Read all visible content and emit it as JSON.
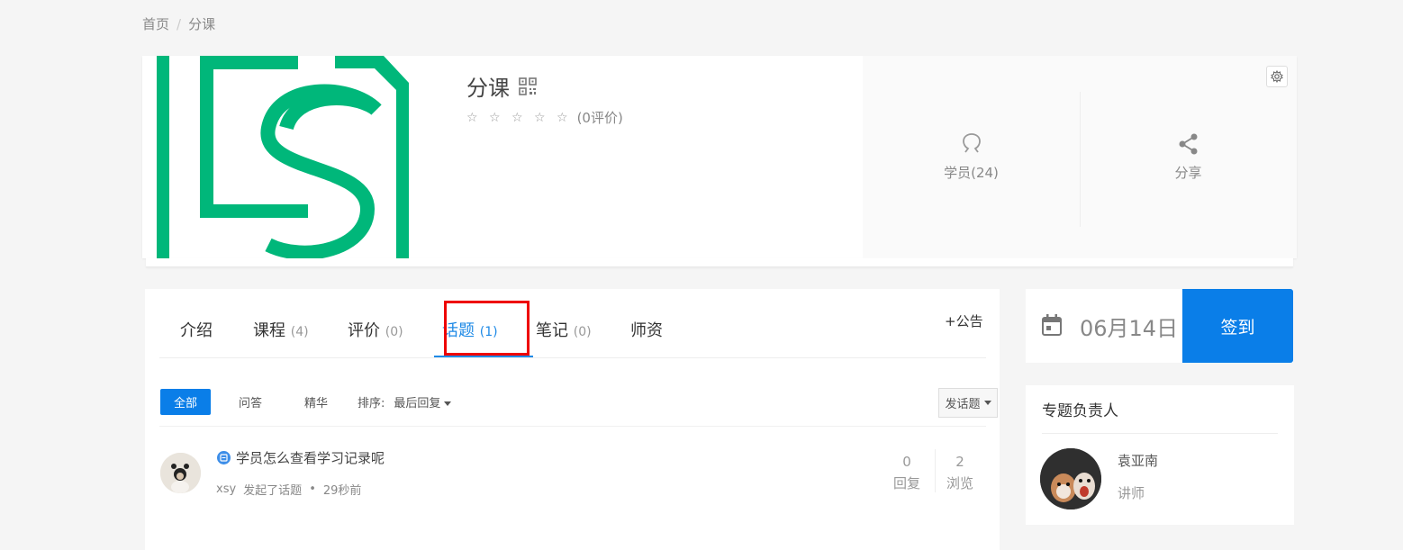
{
  "breadcrumb": {
    "home": "首页",
    "separator": "/",
    "current": "分课"
  },
  "course": {
    "title": "分课",
    "stars": "☆ ☆ ☆ ☆ ☆",
    "rating_text": "(0评价)"
  },
  "stats": {
    "students": "学员(24)",
    "share": "分享"
  },
  "tabs": [
    {
      "label": "介绍",
      "count": ""
    },
    {
      "label": "课程",
      "count": "(4)"
    },
    {
      "label": "评价",
      "count": "(0)"
    },
    {
      "label": "话题",
      "count": "(1)"
    },
    {
      "label": "笔记",
      "count": "(0)"
    },
    {
      "label": "师资",
      "count": ""
    }
  ],
  "announce": "+公告",
  "filters": {
    "all": "全部",
    "qa": "问答",
    "featured": "精华",
    "sort_label": "排序:",
    "sort_value": "最后回复",
    "post_button": "发话题"
  },
  "thread": {
    "title": "学员怎么查看学习记录呢",
    "author": "xsy",
    "action": "发起了话题",
    "dot": "•",
    "time": "29秒前",
    "replies": "0",
    "replies_label": "回复",
    "views": "2",
    "views_label": "浏览"
  },
  "checkin": {
    "date": "06月14日",
    "button": "签到"
  },
  "owner": {
    "title": "专题负责人",
    "name": "袁亚南",
    "role": "讲师"
  },
  "colors": {
    "brand_green": "#00b77a",
    "primary_blue": "#0a7ee8",
    "highlight_red": "#e00000"
  }
}
